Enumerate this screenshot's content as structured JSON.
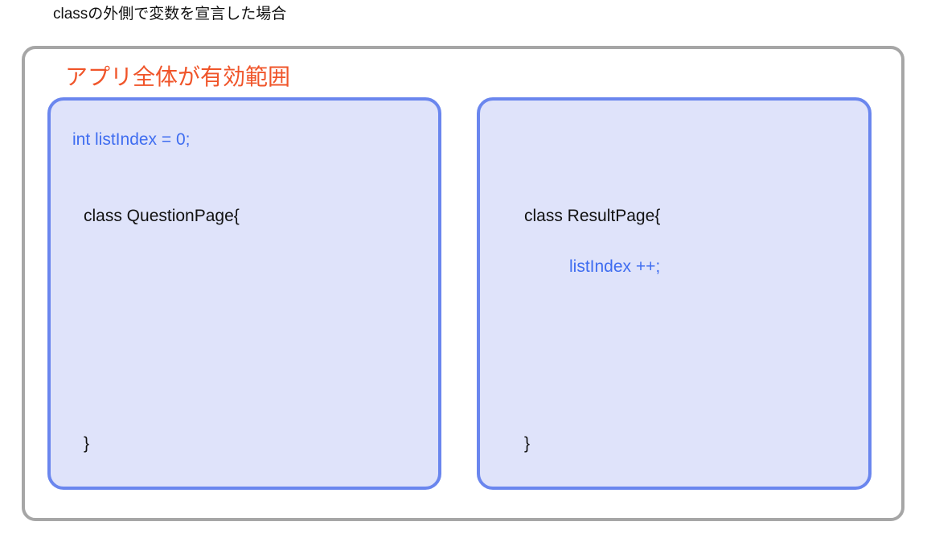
{
  "heading": "classの外側で変数を宣言した場合",
  "scope": {
    "label": "アプリ全体が有効範囲",
    "label_color": "#f0552a",
    "border_color": "#a6a6a6"
  },
  "boxes": {
    "fill_color": "#dfe3fa",
    "border_color": "#6a86ee",
    "left": {
      "declaration": "int listIndex = 0;",
      "class_open": "class QuestionPage{",
      "class_close": "}"
    },
    "right": {
      "class_open": "class ResultPage{",
      "statement": "listIndex ++;",
      "class_close": "}"
    }
  },
  "colors": {
    "code_highlight": "#3f6df0",
    "code_default": "#111111"
  }
}
